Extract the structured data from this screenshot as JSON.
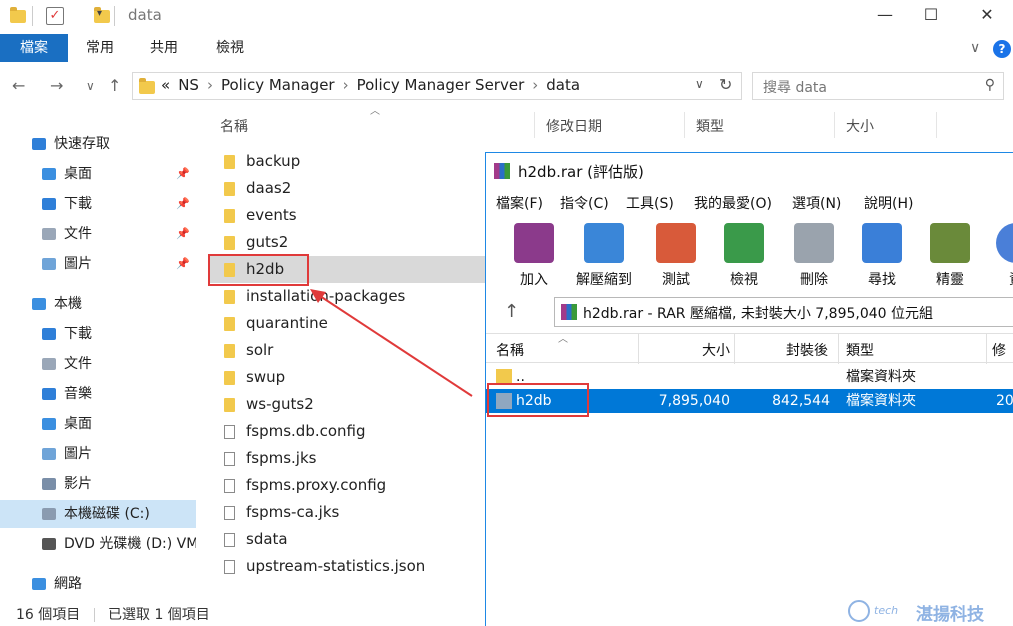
{
  "explorer": {
    "title": "data",
    "ribbon_tabs": [
      "檔案",
      "常用",
      "共用",
      "檢視"
    ],
    "nav": {
      "back": "←",
      "forward": "→",
      "recent": "∨",
      "up": "↑"
    },
    "breadcrumb": [
      "«",
      "NS",
      "Policy Manager",
      "Policy Manager Server",
      "data"
    ],
    "search_placeholder": "搜尋 data",
    "columns": [
      "名稱",
      "修改日期",
      "類型",
      "大小"
    ],
    "sidebar": [
      {
        "label": "快速存取",
        "icon": "star-icon",
        "color": "#2f7fd8",
        "pinned": false,
        "level": 0
      },
      {
        "label": "桌面",
        "icon": "desktop-icon",
        "color": "#3b8fe0",
        "pinned": true,
        "level": 1
      },
      {
        "label": "下載",
        "icon": "download-icon",
        "color": "#2f7fd8",
        "pinned": true,
        "level": 1
      },
      {
        "label": "文件",
        "icon": "documents-icon",
        "color": "#9aa7b8",
        "pinned": true,
        "level": 1
      },
      {
        "label": "圖片",
        "icon": "pictures-icon",
        "color": "#6fa4d8",
        "pinned": true,
        "level": 1
      },
      {
        "label": "本機",
        "icon": "computer-icon",
        "color": "#3b8fe0",
        "pinned": false,
        "level": 0
      },
      {
        "label": "下載",
        "icon": "download-icon",
        "color": "#2f7fd8",
        "pinned": false,
        "level": 1
      },
      {
        "label": "文件",
        "icon": "documents-icon",
        "color": "#9aa7b8",
        "pinned": false,
        "level": 1
      },
      {
        "label": "音樂",
        "icon": "music-icon",
        "color": "#2f7fd8",
        "pinned": false,
        "level": 1
      },
      {
        "label": "桌面",
        "icon": "desktop-icon",
        "color": "#3b8fe0",
        "pinned": false,
        "level": 1
      },
      {
        "label": "圖片",
        "icon": "pictures-icon",
        "color": "#6fa4d8",
        "pinned": false,
        "level": 1
      },
      {
        "label": "影片",
        "icon": "videos-icon",
        "color": "#7a8ea8",
        "pinned": false,
        "level": 1
      },
      {
        "label": "本機磁碟 (C:)",
        "icon": "drive-icon",
        "color": "#8a9bb0",
        "pinned": false,
        "level": 1,
        "selected": true
      },
      {
        "label": "DVD 光碟機 (D:) VM",
        "icon": "dvd-drive-icon",
        "color": "#555555",
        "pinned": false,
        "level": 1
      },
      {
        "label": "網路",
        "icon": "network-icon",
        "color": "#3b8fe0",
        "pinned": false,
        "level": 0
      }
    ],
    "files": [
      {
        "name": "backup",
        "type": "folder"
      },
      {
        "name": "daas2",
        "type": "folder"
      },
      {
        "name": "events",
        "type": "folder"
      },
      {
        "name": "guts2",
        "type": "folder"
      },
      {
        "name": "h2db",
        "type": "folder",
        "selected": true
      },
      {
        "name": "installation-packages",
        "type": "folder"
      },
      {
        "name": "quarantine",
        "type": "folder"
      },
      {
        "name": "solr",
        "type": "folder"
      },
      {
        "name": "swup",
        "type": "folder"
      },
      {
        "name": "ws-guts2",
        "type": "folder"
      },
      {
        "name": "fspms.db.config",
        "type": "file"
      },
      {
        "name": "fspms.jks",
        "type": "file"
      },
      {
        "name": "fspms.proxy.config",
        "type": "file"
      },
      {
        "name": "fspms-ca.jks",
        "type": "file"
      },
      {
        "name": "sdata",
        "type": "file"
      },
      {
        "name": "upstream-statistics.json",
        "type": "file"
      }
    ],
    "status": {
      "count": "16 個項目",
      "selected": "已選取 1 個項目"
    }
  },
  "winrar": {
    "title": "h2db.rar (評估版)",
    "menu": [
      "檔案(F)",
      "指令(C)",
      "工具(S)",
      "我的最愛(O)",
      "選項(N)",
      "說明(H)"
    ],
    "tools": [
      {
        "label": "加入",
        "icon": "add-archive-icon"
      },
      {
        "label": "解壓縮到",
        "icon": "extract-to-icon"
      },
      {
        "label": "測試",
        "icon": "test-icon"
      },
      {
        "label": "檢視",
        "icon": "view-icon"
      },
      {
        "label": "刪除",
        "icon": "delete-icon"
      },
      {
        "label": "尋找",
        "icon": "find-icon"
      },
      {
        "label": "精靈",
        "icon": "wizard-icon"
      },
      {
        "label": "資",
        "icon": "info-icon"
      }
    ],
    "path": "h2db.rar - RAR 壓縮檔, 未封裝大小 7,895,040 位元組",
    "columns": [
      "名稱",
      "大小",
      "封裝後",
      "類型",
      "修"
    ],
    "rows": [
      {
        "name": "..",
        "size": "",
        "packed": "",
        "type": "檔案資料夾",
        "modified": "",
        "selected": false
      },
      {
        "name": "h2db",
        "size": "7,895,040",
        "packed": "842,544",
        "type": "檔案資料夾",
        "modified": "20",
        "selected": true
      }
    ]
  },
  "watermark": {
    "mark": "",
    "small": "tech",
    "text": "湛揚科技"
  }
}
